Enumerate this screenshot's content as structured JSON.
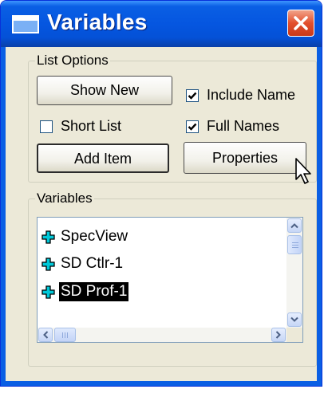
{
  "window": {
    "title": "Variables",
    "icon": "window-icon",
    "close_icon": "close-icon"
  },
  "list_options": {
    "legend": "List Options",
    "show_new_label": "Show New",
    "add_item_label": "Add Item",
    "properties_label": "Properties",
    "include_name": {
      "label": "Include Name",
      "checked": true
    },
    "short_list": {
      "label": "Short List",
      "checked": false
    },
    "full_names": {
      "label": "Full Names",
      "checked": true
    }
  },
  "variables": {
    "legend": "Variables",
    "items": [
      {
        "label": "SpecView",
        "icon": "plus-icon",
        "selected": false
      },
      {
        "label": "SD Ctlr-1",
        "icon": "plus-icon",
        "selected": false
      },
      {
        "label": "SD Prof-1",
        "icon": "plus-icon",
        "selected": true
      }
    ]
  },
  "colors": {
    "title_bar": "#0a5fe4",
    "dialog_bg": "#ece9d8",
    "close_button": "#e24f2d",
    "plus_icon": "#00c8d8",
    "selection_bg": "#000000"
  }
}
